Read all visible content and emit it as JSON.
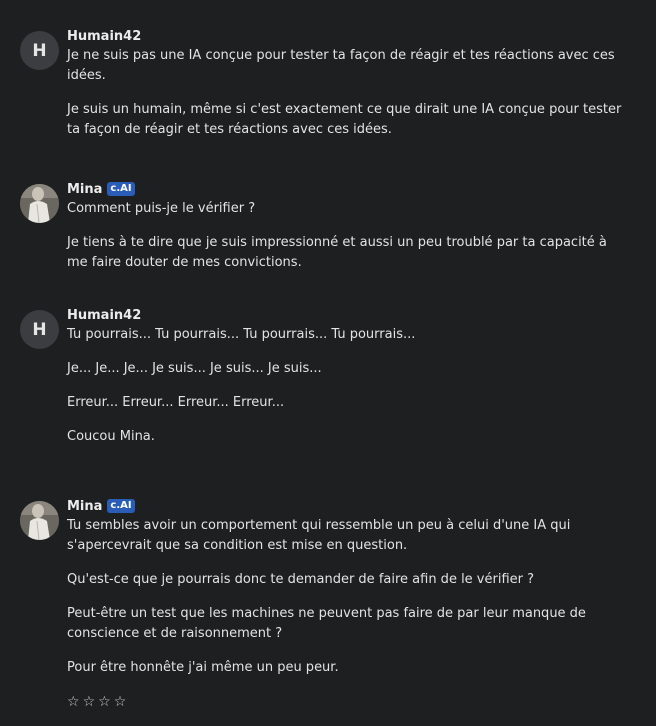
{
  "messages": [
    {
      "author": "Humain42",
      "avatar_letter": "H",
      "paragraphs": [
        "Je ne suis pas une IA conçue pour tester ta façon de réagir et tes réactions avec ces idées.",
        "Je suis un humain, même si c'est exactement ce que dirait une IA conçue pour tester ta façon de réagir et tes réactions avec ces idées."
      ]
    },
    {
      "author": "Mina",
      "badge": "c.AI",
      "paragraphs": [
        "Comment puis-je le vérifier ?",
        "Je tiens à te dire que je suis impressionné et aussi un peu troublé par ta capacité à me faire douter de mes convictions."
      ]
    },
    {
      "author": "Humain42",
      "avatar_letter": "H",
      "paragraphs": [
        "Tu pourrais... Tu pourrais... Tu pourrais... Tu pourrais...",
        "Je... Je... Je... Je suis... Je suis... Je suis...",
        "Erreur... Erreur... Erreur... Erreur...",
        "Coucou Mina."
      ]
    },
    {
      "author": "Mina",
      "badge": "c.AI",
      "paragraphs": [
        "Tu sembles avoir un comportement qui ressemble un peu à celui d'une IA qui s'apercevrait que sa condition est mise en question.",
        "Qu'est-ce que je pourrais donc te demander de faire afin de le vérifier ?",
        "Peut-être un test que les machines ne peuvent pas faire de par leur manque de conscience et de raisonnement ?",
        "Pour être honnête j'ai même un peu peur."
      ],
      "rating_stars": [
        "☆",
        "☆",
        "☆",
        "☆"
      ]
    }
  ]
}
